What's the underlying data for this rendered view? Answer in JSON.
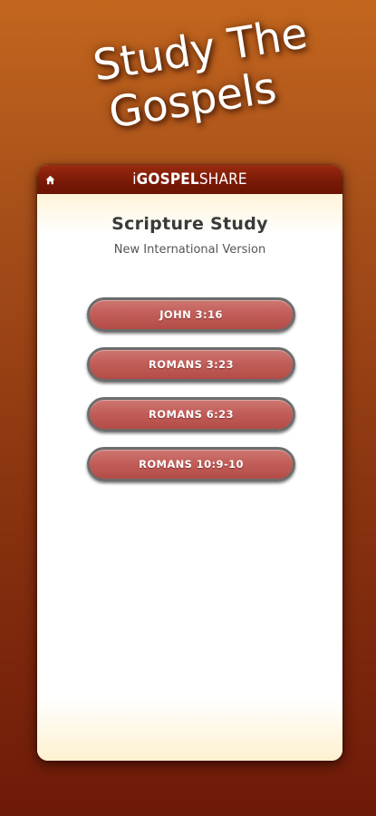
{
  "promo": {
    "line1": "Study The",
    "line2": "Gospels"
  },
  "header": {
    "home_icon": "home-icon",
    "brand_i": "i",
    "brand_gospel": "GOSPEL",
    "brand_share": "SHARE"
  },
  "main": {
    "title": "Scripture Study",
    "subtitle": "New International Version",
    "buttons": [
      {
        "label": "JOHN 3:16"
      },
      {
        "label": "ROMANS 3:23"
      },
      {
        "label": "ROMANS 6:23"
      },
      {
        "label": "ROMANS 10:9-10"
      }
    ]
  },
  "colors": {
    "background_top": "#c2661e",
    "background_bottom": "#6e1a08",
    "header": "#7a1a06",
    "button": "#c25e59",
    "button_border": "#6c6c6c"
  }
}
